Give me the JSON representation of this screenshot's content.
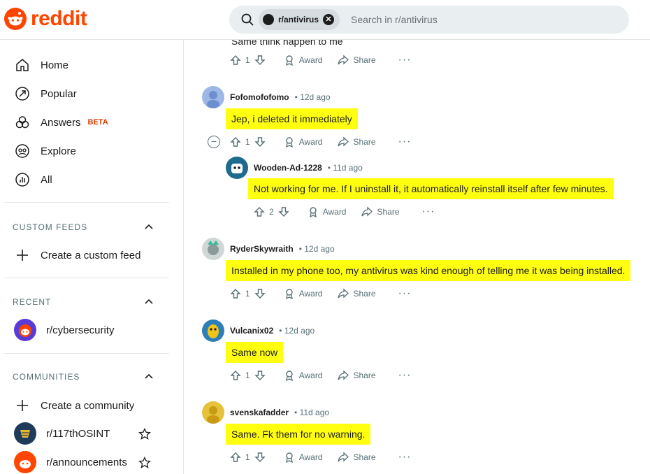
{
  "header": {
    "logo_text": "reddit",
    "search_chip": "r/antivirus",
    "search_placeholder": "Search in r/antivirus"
  },
  "sidebar": {
    "nav": [
      {
        "label": "Home",
        "icon": "home-icon"
      },
      {
        "label": "Popular",
        "icon": "popular-icon"
      },
      {
        "label": "Answers",
        "icon": "answers-icon",
        "badge": "BETA"
      },
      {
        "label": "Explore",
        "icon": "explore-icon"
      },
      {
        "label": "All",
        "icon": "all-icon"
      }
    ],
    "custom_feeds": {
      "title": "CUSTOM FEEDS",
      "create_label": "Create a custom feed"
    },
    "recent": {
      "title": "RECENT",
      "items": [
        {
          "label": "r/cybersecurity"
        }
      ]
    },
    "communities": {
      "title": "COMMUNITIES",
      "create_label": "Create a community",
      "items": [
        {
          "label": "r/117thOSINT"
        },
        {
          "label": "r/announcements"
        }
      ]
    }
  },
  "actions": {
    "award": "Award",
    "share": "Share",
    "more": "···"
  },
  "top_partial": {
    "text": "Same think happen to me",
    "votes": "1"
  },
  "comments": [
    {
      "user": "Fofomofofomo",
      "age": "12d ago",
      "text": "Jep, i deleted it immediately",
      "votes": "1"
    },
    {
      "user": "Wooden-Ad-1228",
      "age": "11d ago",
      "text": "Not working for me. If I uninstall it, it automatically reinstall itself after few minutes.",
      "votes": "2"
    },
    {
      "user": "RyderSkywraith",
      "age": "12d ago",
      "text": "Installed in my phone too, my antivirus was kind enough of telling me it was being installed.",
      "votes": "1"
    },
    {
      "user": "Vulcanix02",
      "age": "12d ago",
      "text": "Same now",
      "votes": "1"
    },
    {
      "user": "svenskafadder",
      "age": "11d ago",
      "text": "Same. Fk them for no warning.",
      "votes": "1"
    }
  ],
  "colors": {
    "brand": "#ff4500",
    "highlight": "#ffff0f",
    "muted": "#576f76"
  }
}
